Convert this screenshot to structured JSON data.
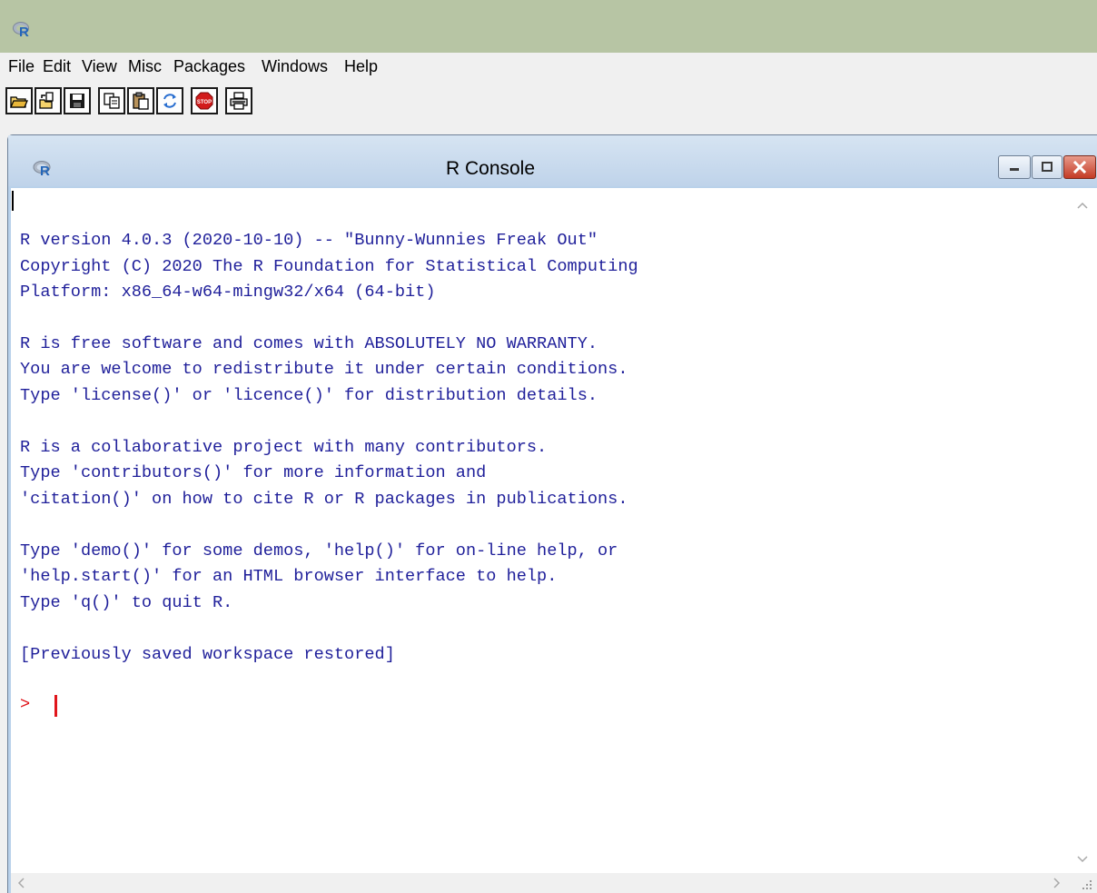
{
  "app": {
    "icon": "r-logo-icon"
  },
  "menu": {
    "items": [
      "File",
      "Edit",
      "View",
      "Misc",
      "Packages",
      "Windows",
      "Help"
    ]
  },
  "toolbar": {
    "buttons": [
      {
        "name": "open-script-button",
        "icon": "open-folder-icon"
      },
      {
        "name": "load-workspace-button",
        "icon": "load-workspace-icon"
      },
      {
        "name": "save-workspace-button",
        "icon": "save-disk-icon"
      },
      {
        "name": "copy-button",
        "icon": "copy-icon"
      },
      {
        "name": "paste-button",
        "icon": "paste-icon"
      },
      {
        "name": "copy-paste-button",
        "icon": "refresh-icon"
      },
      {
        "name": "stop-button",
        "icon": "stop-sign-icon"
      },
      {
        "name": "print-button",
        "icon": "printer-icon"
      }
    ],
    "stop_label": "STOP"
  },
  "console_window": {
    "title": "R Console",
    "icon": "r-logo-icon",
    "controls": [
      "minimize",
      "maximize",
      "close"
    ]
  },
  "console": {
    "lines": [
      "R version 4.0.3 (2020-10-10) -- \"Bunny-Wunnies Freak Out\"",
      "Copyright (C) 2020 The R Foundation for Statistical Computing",
      "Platform: x86_64-w64-mingw32/x64 (64-bit)",
      "",
      "R is free software and comes with ABSOLUTELY NO WARRANTY.",
      "You are welcome to redistribute it under certain conditions.",
      "Type 'license()' or 'licence()' for distribution details.",
      "",
      "R is a collaborative project with many contributors.",
      "Type 'contributors()' for more information and",
      "'citation()' on how to cite R or R packages in publications.",
      "",
      "Type 'demo()' for some demos, 'help()' for on-line help, or",
      "'help.start()' for an HTML browser interface to help.",
      "Type 'q()' to quit R.",
      "",
      "[Previously saved workspace restored]"
    ],
    "prompt": ">",
    "colors": {
      "output": "#1f1f9a",
      "prompt": "#e0151b"
    }
  }
}
